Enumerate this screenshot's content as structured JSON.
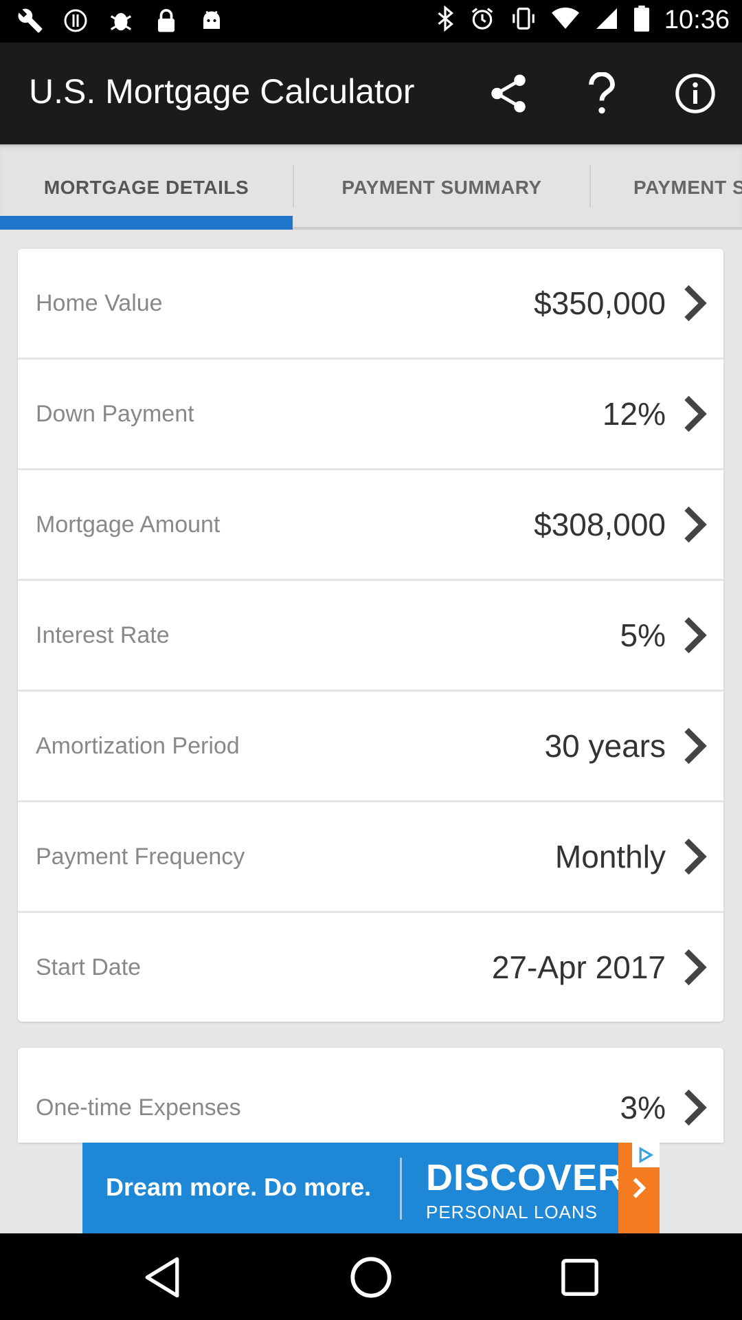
{
  "status_bar": {
    "time": "10:36",
    "left_icons": [
      "wrench-icon",
      "alert-circle-icon",
      "bug-icon",
      "lock-icon",
      "android-icon"
    ],
    "right_icons": [
      "bluetooth-icon",
      "alarm-icon",
      "vibrate-icon",
      "wifi-icon",
      "signal-icon",
      "battery-icon"
    ]
  },
  "app_bar": {
    "title": "U.S. Mortgage Calculator",
    "actions": [
      "share-icon",
      "help-icon",
      "info-icon"
    ]
  },
  "tabs": [
    {
      "label": "MORTGAGE DETAILS",
      "active": true
    },
    {
      "label": "PAYMENT SUMMARY",
      "active": false
    },
    {
      "label": "PAYMENT S",
      "active": false
    }
  ],
  "details": [
    {
      "label": "Home Value",
      "value": "$350,000"
    },
    {
      "label": "Down Payment",
      "value": "12%"
    },
    {
      "label": "Mortgage Amount",
      "value": "$308,000"
    },
    {
      "label": "Interest Rate",
      "value": "5%"
    },
    {
      "label": "Amortization Period",
      "value": "30 years"
    },
    {
      "label": "Payment Frequency",
      "value": "Monthly"
    },
    {
      "label": "Start Date",
      "value": "27-Apr 2017"
    }
  ],
  "expenses": [
    {
      "label": "One-time Expenses",
      "value": "3%"
    }
  ],
  "ad": {
    "tagline": "Dream more. Do more.",
    "brand": "DISCOVER",
    "subtitle": "PERSONAL LOANS"
  },
  "colors": {
    "accent": "#1f74cc",
    "app_bar": "#1b1b1b",
    "background": "#e6e6e6",
    "ad_blue": "#1e87d6",
    "ad_orange": "#f47b20"
  },
  "nav": [
    "back-icon",
    "home-icon",
    "recents-icon"
  ]
}
